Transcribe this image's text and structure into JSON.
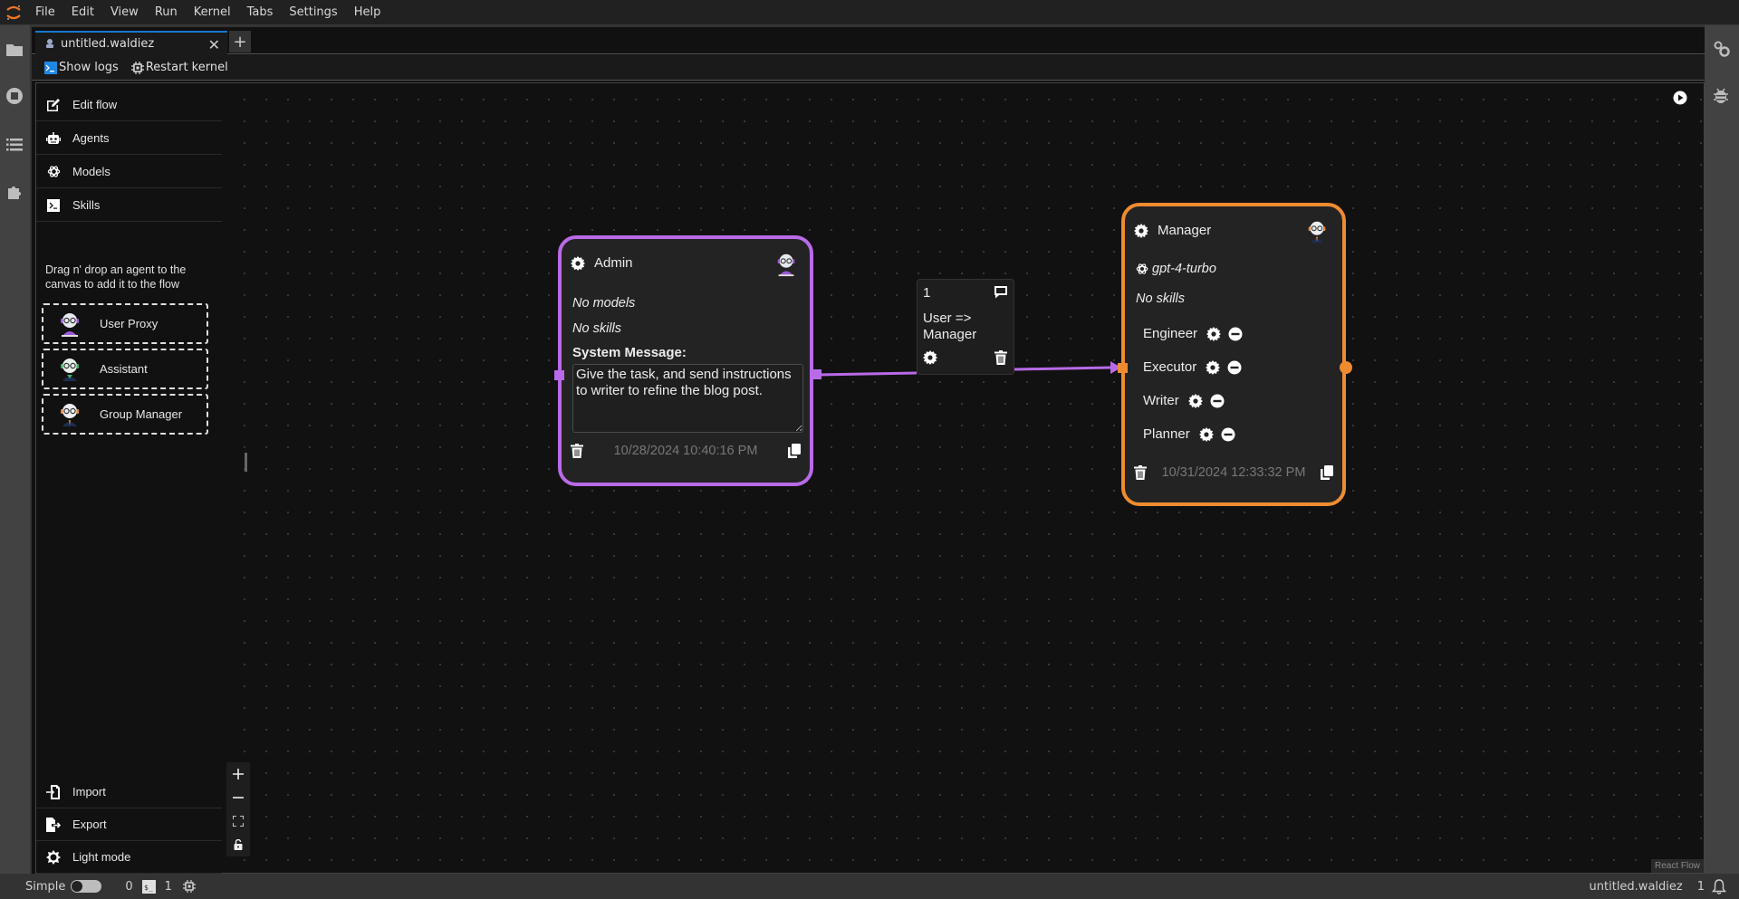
{
  "menubar": {
    "items": [
      "File",
      "Edit",
      "View",
      "Run",
      "Kernel",
      "Tabs",
      "Settings",
      "Help"
    ]
  },
  "tab": {
    "title": "untitled.waldiez",
    "add_label": "+",
    "close_label": "✕"
  },
  "toolbar": {
    "show_logs": "Show logs",
    "restart_kernel": "Restart kernel"
  },
  "sidebar": {
    "top_items": [
      {
        "label": "Edit flow",
        "icon": "edit-icon"
      },
      {
        "label": "Agents",
        "icon": "robot-icon"
      },
      {
        "label": "Models",
        "icon": "openai-icon"
      },
      {
        "label": "Skills",
        "icon": "terminal-icon"
      }
    ],
    "hint": "Drag n' drop an agent to the canvas to add it to the flow",
    "agents": [
      {
        "label": "User Proxy",
        "accent": "#9b59d6"
      },
      {
        "label": "Assistant",
        "accent": "#3bb36a"
      },
      {
        "label": "Group Manager",
        "accent": "#e88a3c"
      }
    ],
    "bottom_items": [
      {
        "label": "Import",
        "icon": "import-icon"
      },
      {
        "label": "Export",
        "icon": "export-icon"
      },
      {
        "label": "Light mode",
        "icon": "sun-icon"
      }
    ]
  },
  "nodes": {
    "admin": {
      "title": "Admin",
      "models": "No models",
      "skills": "No skills",
      "system_message_label": "System Message:",
      "system_message": "Give the task, and send instructions to writer to refine the blog post.",
      "date": "10/28/2024 10:40:16 PM",
      "color": "#b96ae8"
    },
    "manager": {
      "title": "Manager",
      "model": "gpt-4-turbo",
      "skills": "No skills",
      "members": [
        "Engineer",
        "Executor",
        "Writer",
        "Planner"
      ],
      "date": "10/31/2024 12:33:32 PM",
      "color": "#ef8c30"
    }
  },
  "edge": {
    "order": "1",
    "label": "User => Manager",
    "color": "#b96ae8"
  },
  "canvas": {
    "attribution": "React Flow"
  },
  "statusbar": {
    "mode_label": "Simple",
    "terminals_count": "0",
    "kernels_count": "1",
    "document_name": "untitled.waldiez",
    "notifications_count": "1"
  }
}
